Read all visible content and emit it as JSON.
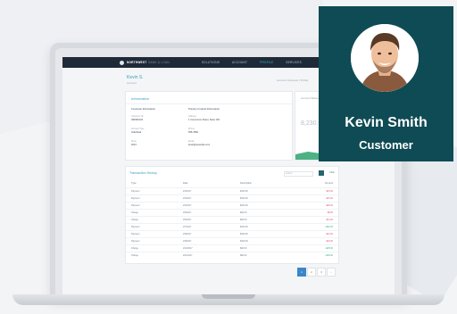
{
  "app": {
    "brand": "NORTHWEST",
    "brand_sub": "BANK & LOAN",
    "nav": [
      "SOLUTIONS",
      "ACCOUNT",
      "PROFILE",
      "SERVICES"
    ],
    "active_nav_index": 2
  },
  "page": {
    "title": "Kevin S.",
    "subtitle": "Account",
    "breadcrumb": "Account Overview / Profile"
  },
  "info_card": {
    "title": "Information",
    "left_header": "Customer Information",
    "right_header": "Primary Contact Information",
    "fields_left": [
      {
        "label": "Customer ID",
        "value": "482930123"
      },
      {
        "label": "Account Type",
        "value": "Individual"
      },
      {
        "label": "Since",
        "value": "2013"
      }
    ],
    "fields_right": [
      {
        "label": "Address",
        "value": "1 Commerce Street, Suite 100"
      },
      {
        "label": "Phone",
        "value": "555-7890"
      },
      {
        "label": "Email",
        "value": "kevin@example.com"
      }
    ]
  },
  "right_card": {
    "title": "Account Balance",
    "amount": "8,230.00"
  },
  "transactions": {
    "title": "Transaction History",
    "search_placeholder": "Search",
    "filter_label": "Filter",
    "columns": [
      "Type",
      "Date",
      "Description",
      "Amount"
    ],
    "rows": [
      {
        "type": "Payment",
        "date": "2/3/2017",
        "desc": "$100.00",
        "amount": "-$10.00",
        "sign": "neg"
      },
      {
        "type": "Payment",
        "date": "2/3/2017",
        "desc": "$100.00",
        "amount": "-$15.00",
        "sign": "neg"
      },
      {
        "type": "Payment",
        "date": "2/4/2017",
        "desc": "$100.00",
        "amount": "-$20.00",
        "sign": "neg"
      },
      {
        "type": "Charge",
        "date": "2/5/2017",
        "desc": "$20.00",
        "amount": "-$8.00",
        "sign": "neg"
      },
      {
        "type": "Charge",
        "date": "2/6/2017",
        "desc": "$20.00",
        "amount": "-$12.00",
        "sign": "neg"
      },
      {
        "type": "Payment",
        "date": "2/7/2017",
        "desc": "$100.00",
        "amount": "+$40.00",
        "sign": "pos"
      },
      {
        "type": "Payment",
        "date": "2/8/2017",
        "desc": "$100.00",
        "amount": "-$10.00",
        "sign": "neg"
      },
      {
        "type": "Payment",
        "date": "2/9/2017",
        "desc": "$100.00",
        "amount": "-$18.00",
        "sign": "neg"
      },
      {
        "type": "Charge",
        "date": "2/10/2017",
        "desc": "$20.00",
        "amount": "+$25.00",
        "sign": "pos"
      },
      {
        "type": "Charge",
        "date": "2/11/2017",
        "desc": "$20.00",
        "amount": "+$30.00",
        "sign": "pos"
      }
    ]
  },
  "pagination": [
    "1",
    "2",
    "3",
    "›"
  ],
  "profile": {
    "name": "Kevin Smith",
    "role": "Customer"
  },
  "colors": {
    "profile_bg": "#0f4b54",
    "nav_bg": "#1f2a38",
    "accent": "#3a9fc0",
    "negative": "#e05566",
    "positive": "#31b27a"
  }
}
